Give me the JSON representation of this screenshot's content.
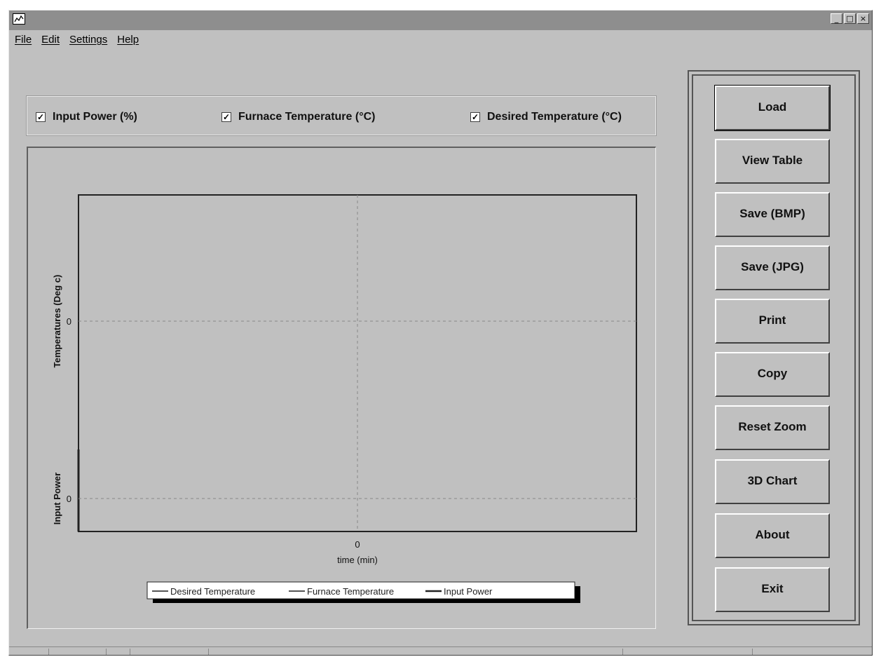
{
  "window": {
    "controls": [
      "_",
      "□",
      "×"
    ]
  },
  "menu": [
    "File",
    "Edit",
    "Settings",
    "Help"
  ],
  "series_toggles": [
    {
      "label": "Input Power (%)",
      "checked": true
    },
    {
      "label": "Furnace Temperature (°C)",
      "checked": true
    },
    {
      "label": "Desired Temperature (°C)",
      "checked": true
    }
  ],
  "buttons": [
    "Load",
    "View Table",
    "Save (BMP)",
    "Save (JPG)",
    "Print",
    "Copy",
    "Reset Zoom",
    "3D Chart",
    "About",
    "Exit"
  ],
  "chart_data": {
    "type": "line",
    "x": [],
    "series": [
      {
        "name": "Desired Temperature",
        "values": []
      },
      {
        "name": "Furnace Temperature",
        "values": []
      },
      {
        "name": "Input Power",
        "values": []
      }
    ],
    "xlabel": "time (min)",
    "ylabel_upper": "Temperatures (Deg c)",
    "ylabel_lower": "Input Power",
    "x_ticks": [
      "0"
    ],
    "y_ticks_upper": [
      "0"
    ],
    "y_ticks_lower": [
      "0"
    ],
    "grid": true,
    "legend_position": "bottom"
  }
}
